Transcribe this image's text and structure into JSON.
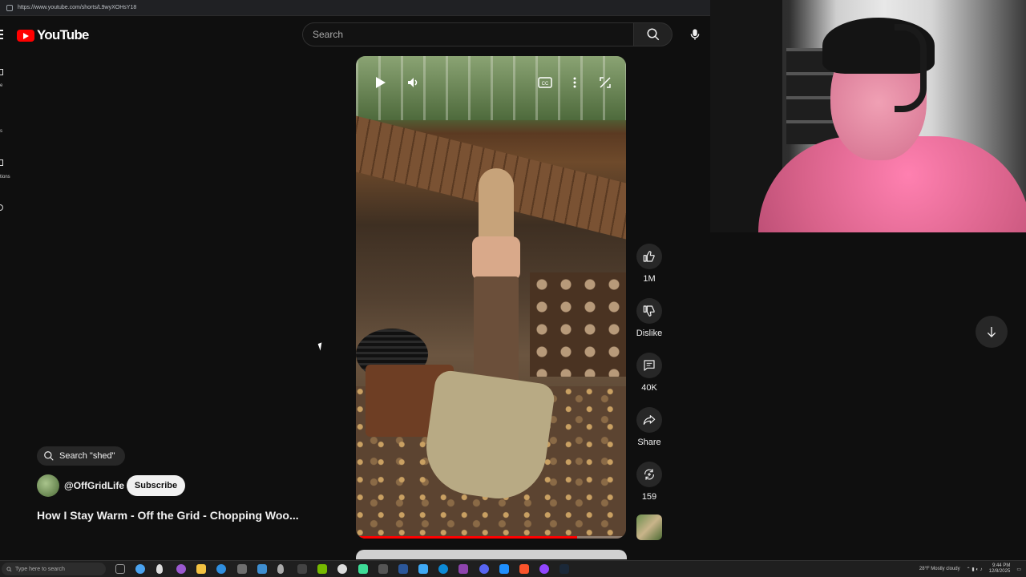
{
  "browser": {
    "url": "https://www.youtube.com/shorts/L9wyXOHsY18"
  },
  "header": {
    "logo_text": "YouTube",
    "search_placeholder": "Search",
    "colors": {
      "brand": "#ff0000",
      "background": "#0f0f0f"
    }
  },
  "sidebar": {
    "fragments": [
      "e",
      "s",
      "tions"
    ]
  },
  "video": {
    "progress_fraction": 0.82,
    "controls": [
      "play-icon",
      "volume-icon",
      "captions-icon",
      "more-icon",
      "fullscreen-icon"
    ]
  },
  "actions": {
    "like_count": "1M",
    "dislike_label": "Dislike",
    "comments_count": "40K",
    "share_label": "Share",
    "remix_count": "159"
  },
  "info": {
    "search_chip": "Search \"shed\"",
    "channel_handle": "@OffGridLife",
    "subscribe_label": "Subscribe",
    "title": "How I Stay Warm - Off the Grid - Chopping Woo..."
  },
  "taskbar": {
    "search_placeholder": "Type here to search",
    "weather": "28°F  Mostly cloudy",
    "time": "9:44 PM",
    "date": "12/8/2025"
  }
}
